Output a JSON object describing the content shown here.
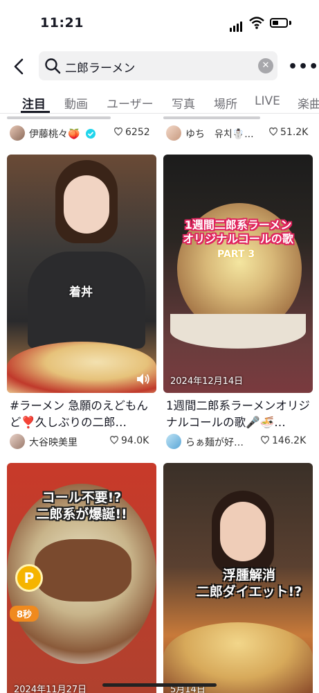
{
  "status_bar": {
    "time": "11:21"
  },
  "search": {
    "query": "二郎ラーメン",
    "clear_label": "✕",
    "more_label": "•••"
  },
  "tabs": [
    {
      "label": "注目",
      "active": true
    },
    {
      "label": "動画"
    },
    {
      "label": "ユーザー"
    },
    {
      "label": "写真"
    },
    {
      "label": "場所"
    },
    {
      "label": "LIVE"
    },
    {
      "label": "楽曲"
    }
  ],
  "partial_row": [
    {
      "author": "伊藤桃々🍑",
      "verified": true,
      "likes": "6252"
    },
    {
      "author": "ゆち　유치☃️...",
      "likes": "51.2K"
    }
  ],
  "cards": [
    {
      "overlay": "着丼",
      "caption": "#ラーメン 急願のえどもんど❣️久しぶりの二郎…",
      "author": "大谷映美里",
      "likes": "94.0K"
    },
    {
      "overlay_title": "1週間二郎系ラーメン\nオリジナルコールの歌",
      "overlay_sub": "PART 3",
      "date": "2024年12月14日",
      "caption": "1週間二郎系ラーメンオリジナルコールの歌🎤🍜…",
      "author": "らぁ麺が好…",
      "likes": "146.2K"
    },
    {
      "overlay_title": "コール不要!?\n二郎系が爆誕!!",
      "badge": "8秒",
      "p_badge": "P",
      "date": "2024年11月27日"
    },
    {
      "overlay_title": "浮腫解消\n二郎ダイエット!?",
      "date": "5月14日"
    }
  ],
  "colors": {
    "accent": "#fe2c55",
    "verified": "#20d5ec",
    "overlay_red": "#e0245e",
    "badge_orange": "#f08a1e"
  }
}
